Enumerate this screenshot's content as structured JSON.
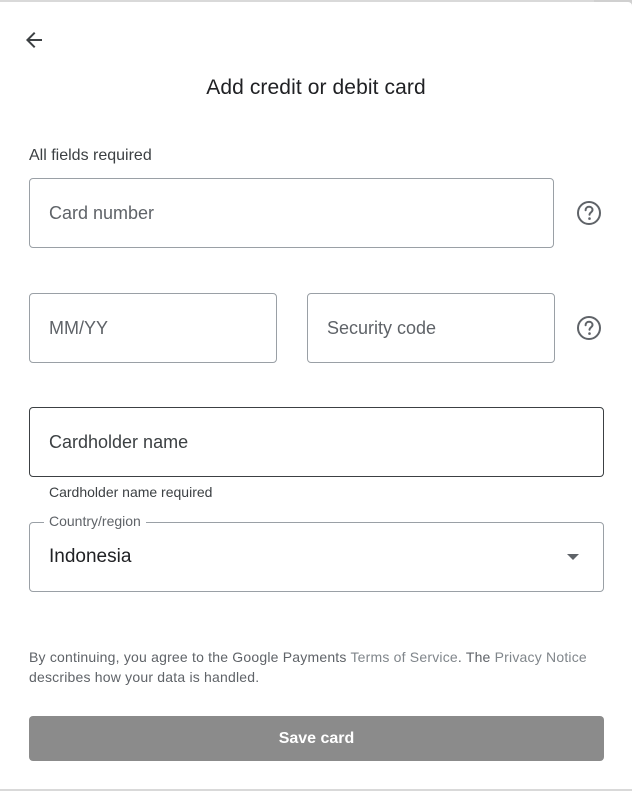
{
  "header": {
    "back_icon": "arrow-left-icon",
    "title": "Add credit or debit card"
  },
  "form": {
    "required_note": "All fields required",
    "card_number": {
      "placeholder": "Card number",
      "value": ""
    },
    "expiry": {
      "placeholder": "MM/YY",
      "value": ""
    },
    "security_code": {
      "placeholder": "Security code",
      "value": ""
    },
    "cardholder_name": {
      "placeholder": "Cardholder name",
      "value": "",
      "error": "Cardholder name required"
    },
    "country": {
      "label": "Country/region",
      "value": "Indonesia"
    },
    "help_icon": "help-circle-icon"
  },
  "legal": {
    "text_before": "By continuing, you agree to the Google Payments ",
    "terms_link": "Terms of Service",
    "text_middle": ". The ",
    "privacy_link": "Privacy Notice",
    "text_after": " describes how your data is handled."
  },
  "actions": {
    "save_label": "Save card"
  },
  "colors": {
    "primary_text": "#202124",
    "secondary_text": "#5f6368",
    "border": "#9aa0a6",
    "button_disabled": "#8b8b8b",
    "link": "#80868b"
  }
}
